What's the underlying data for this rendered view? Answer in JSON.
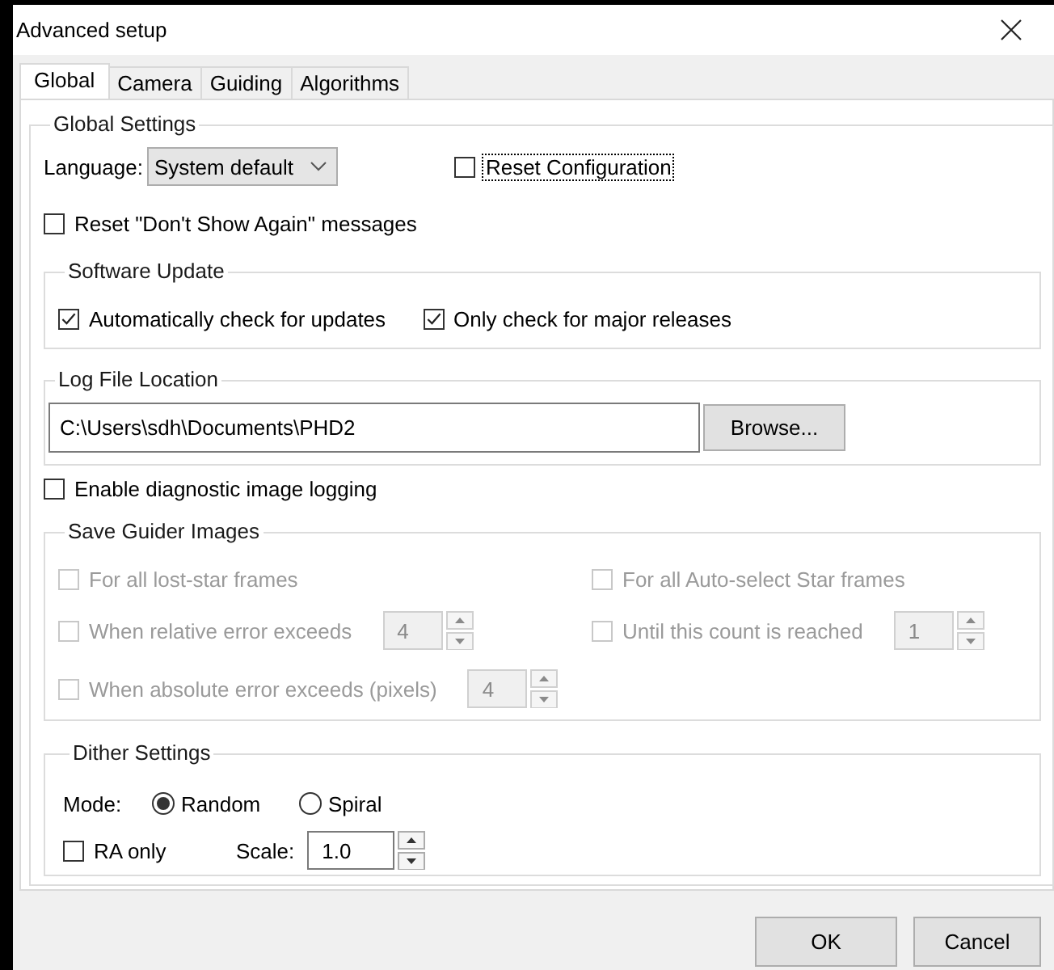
{
  "window": {
    "title": "Advanced setup"
  },
  "tabs": [
    {
      "label": "Global",
      "selected": true
    },
    {
      "label": "Camera",
      "selected": false
    },
    {
      "label": "Guiding",
      "selected": false
    },
    {
      "label": "Algorithms",
      "selected": false
    }
  ],
  "global_settings": {
    "title": "Global Settings",
    "language": {
      "label": "Language:",
      "value": "System default"
    },
    "reset_configuration": {
      "label": "Reset Configuration",
      "checked": false,
      "focused": true
    },
    "reset_dont_show": {
      "label": "Reset \"Don't Show Again\" messages",
      "checked": false
    },
    "software_update": {
      "title": "Software Update",
      "options": [
        {
          "label": "Automatically check for updates",
          "checked": true
        },
        {
          "label": "Only check for major releases",
          "checked": true
        }
      ]
    },
    "log_file": {
      "title": "Log File Location",
      "path": "C:\\Users\\sdh\\Documents\\PHD2",
      "browse": "Browse..."
    },
    "diagnostic_logging": {
      "label": "Enable diagnostic image logging",
      "checked": false
    },
    "save_guider_images": {
      "title": "Save Guider Images",
      "items": [
        {
          "kind": "check",
          "label": "For all lost-star frames",
          "checked": false,
          "disabled": true
        },
        {
          "kind": "check",
          "label": "For all Auto-select Star frames",
          "checked": false,
          "disabled": true
        },
        {
          "kind": "check_spin",
          "label": "When relative error exceeds",
          "checked": false,
          "disabled": true,
          "value": "4"
        },
        {
          "kind": "check_spin",
          "label": "Until this count is reached",
          "checked": false,
          "disabled": true,
          "value": "1"
        },
        {
          "kind": "check_spin",
          "label": "When absolute error exceeds (pixels)",
          "checked": false,
          "disabled": true,
          "value": "4"
        }
      ]
    },
    "dither": {
      "title": "Dither Settings",
      "mode_label": "Mode:",
      "modes": [
        {
          "label": "Random",
          "selected": true
        },
        {
          "label": "Spiral",
          "selected": false
        }
      ],
      "ra_only": {
        "label": "RA only",
        "checked": false
      },
      "scale": {
        "label": "Scale:",
        "value": "1.0"
      }
    }
  },
  "buttons": [
    "OK",
    "Cancel"
  ]
}
